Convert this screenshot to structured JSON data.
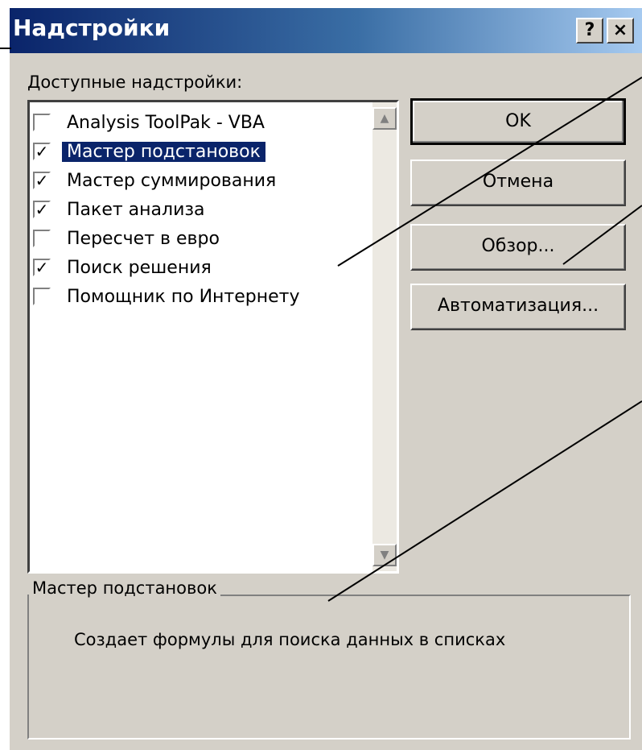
{
  "dialog": {
    "title": "Надстройки",
    "help_label": "?",
    "close_label": "×"
  },
  "addins": {
    "label": "Доступные надстройки:",
    "items": [
      {
        "label": "Analysis ToolPak - VBA",
        "checked": false,
        "mark": ""
      },
      {
        "label": "Мастер подстановок",
        "checked": true,
        "mark": "✓",
        "selected": true
      },
      {
        "label": "Мастер суммирования",
        "checked": true,
        "mark": "✓"
      },
      {
        "label": "Пакет анализа",
        "checked": true,
        "mark": "✓"
      },
      {
        "label": "Пересчет в евро",
        "checked": false,
        "mark": ""
      },
      {
        "label": "Поиск решения",
        "checked": true,
        "mark": "✓"
      },
      {
        "label": "Помощник по Интернету",
        "checked": false,
        "mark": ""
      }
    ],
    "scroll_up": "▲",
    "scroll_down": "▼"
  },
  "buttons": {
    "ok": "OK",
    "cancel": "Отмена",
    "browse": "Обзор...",
    "automation": "Автоматизация..."
  },
  "description": {
    "legend": "Мастер подстановок",
    "text": "Создает формулы для поиска данных в списках"
  }
}
